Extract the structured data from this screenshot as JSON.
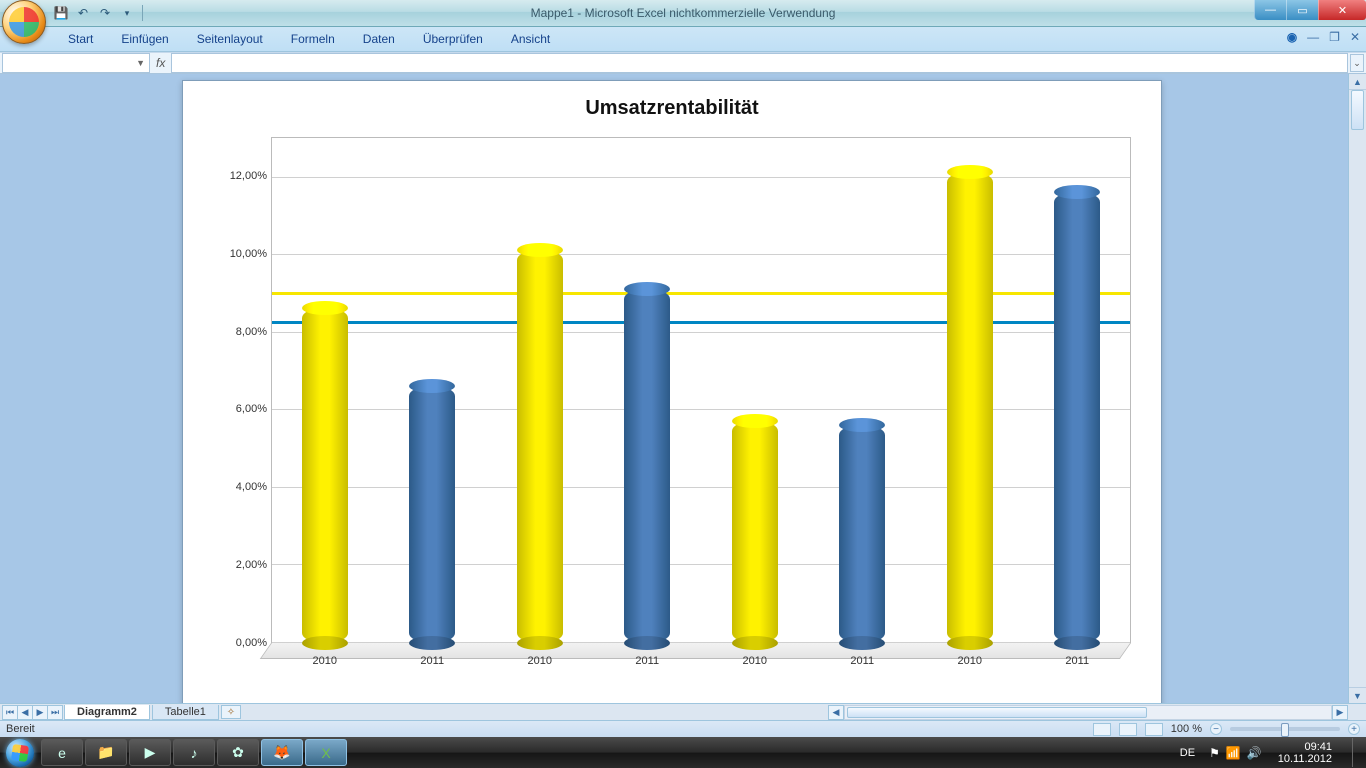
{
  "window": {
    "title": "Mappe1 - Microsoft Excel nichtkommerzielle Verwendung"
  },
  "ribbon": {
    "tabs": [
      "Start",
      "Einfügen",
      "Seitenlayout",
      "Formeln",
      "Daten",
      "Überprüfen",
      "Ansicht"
    ]
  },
  "formula_bar": {
    "name_box": "",
    "fx_label": "fx"
  },
  "sheet_tabs": {
    "active": "Diagramm2",
    "inactive": "Tabelle1"
  },
  "statusbar": {
    "left": "Bereit",
    "zoom": "100 %"
  },
  "taskbar": {
    "lang": "DE",
    "time": "09:41",
    "date": "10.11.2012"
  },
  "chart_data": {
    "type": "bar",
    "title": "Umsatzrentabilität",
    "categories": [
      "2010",
      "2011",
      "2010",
      "2011",
      "2010",
      "2011",
      "2010",
      "2011"
    ],
    "values_pct": [
      8.6,
      6.6,
      10.1,
      9.1,
      5.7,
      5.6,
      12.1,
      11.6
    ],
    "colors": [
      "yellow",
      "blue",
      "yellow",
      "blue",
      "yellow",
      "blue",
      "yellow",
      "blue"
    ],
    "reference_lines": [
      {
        "color": "yellow",
        "value_pct": 9.0
      },
      {
        "color": "blue",
        "value_pct": 8.25
      }
    ],
    "y_ticks_pct": [
      0,
      2,
      4,
      6,
      8,
      10,
      12
    ],
    "y_tick_labels": [
      "0,00%",
      "2,00%",
      "4,00%",
      "6,00%",
      "8,00%",
      "10,00%",
      "12,00%"
    ],
    "ylim_pct": [
      0,
      13
    ],
    "xlabel": "",
    "ylabel": ""
  }
}
